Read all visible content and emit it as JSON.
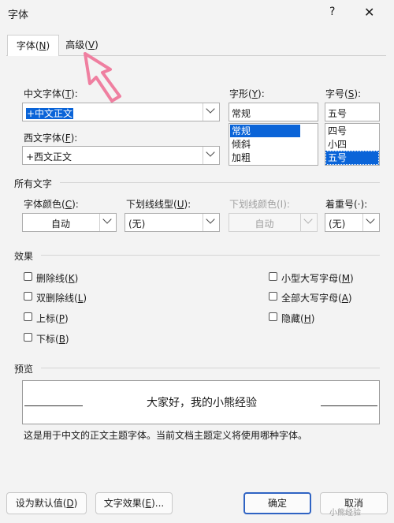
{
  "window": {
    "title": "字体",
    "help_glyph": "?",
    "close_glyph": "✕"
  },
  "tabs": [
    {
      "label": "字体(",
      "key": "N",
      "suffix": ")"
    },
    {
      "label": "高级(",
      "key": "V",
      "suffix": ")"
    }
  ],
  "font": {
    "chinese_label": "中文字体(",
    "chinese_key": "T",
    "chinese_suffix": "):",
    "chinese_value": "+中文正文",
    "western_label": "西文字体(",
    "western_key": "F",
    "western_suffix": "):",
    "western_value": "+西文正文",
    "style_label": "字形(",
    "style_key": "Y",
    "style_suffix": "):",
    "style_value": "常规",
    "style_options": [
      "常规",
      "倾斜",
      "加粗"
    ],
    "size_label": "字号(",
    "size_key": "S",
    "size_suffix": "):",
    "size_value": "五号",
    "size_options": [
      "四号",
      "小四",
      "五号"
    ]
  },
  "all_text": {
    "section": "所有文字",
    "color_label": "字体颜色(",
    "color_key": "C",
    "color_suffix": "):",
    "color_value": "自动",
    "underline_label": "下划线线型(",
    "underline_key": "U",
    "underline_suffix": "):",
    "underline_value": "(无)",
    "underline_color_label": "下划线颜色(I):",
    "underline_color_value": "自动",
    "emphasis_label": "着重号(·):",
    "emphasis_value": "(无)"
  },
  "effects": {
    "section": "效果",
    "left": [
      {
        "label": "删除线(",
        "key": "K",
        "suffix": ")"
      },
      {
        "label": "双删除线(",
        "key": "L",
        "suffix": ")"
      },
      {
        "label": "上标(",
        "key": "P",
        "suffix": ")"
      },
      {
        "label": "下标(",
        "key": "B",
        "suffix": ")"
      }
    ],
    "right": [
      {
        "label": "小型大写字母(",
        "key": "M",
        "suffix": ")"
      },
      {
        "label": "全部大写字母(",
        "key": "A",
        "suffix": ")"
      },
      {
        "label": "隐藏(",
        "key": "H",
        "suffix": ")"
      }
    ]
  },
  "preview": {
    "section": "预览",
    "sample": "大家好，我的小熊经验",
    "note": "这是用于中文的正文主题字体。当前文档主题定义将使用哪种字体。"
  },
  "buttons": {
    "default_label": "设为默认值(",
    "default_key": "D",
    "default_suffix": ")",
    "effects_label": "文字效果(",
    "effects_key": "E",
    "effects_suffix": ")...",
    "ok": "确定",
    "cancel": "取消"
  },
  "watermark": "小熊经验",
  "colors": {
    "accent": "#0a64d8",
    "pointer": "#ef7fa0",
    "primary_border": "#2f63c3"
  }
}
